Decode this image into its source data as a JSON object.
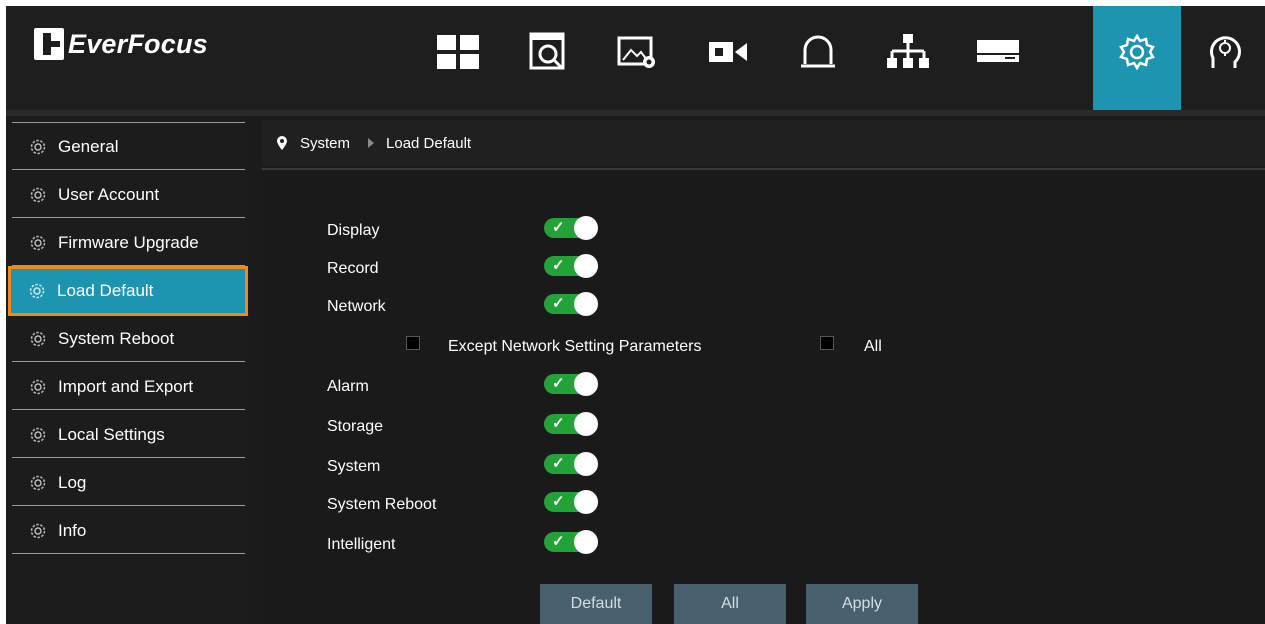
{
  "brand": {
    "name": "EverFocus"
  },
  "topnav": {
    "icons": [
      {
        "name": "live-view-grid"
      },
      {
        "name": "playback-search"
      },
      {
        "name": "image-settings"
      },
      {
        "name": "camera"
      },
      {
        "name": "alarm-bell"
      },
      {
        "name": "network"
      },
      {
        "name": "storage-hdd"
      },
      {
        "name": "system-settings",
        "active": true
      },
      {
        "name": "intelligent-analytics"
      }
    ],
    "active_color": "#1e95b0"
  },
  "sidebar": {
    "items": [
      {
        "label": "General"
      },
      {
        "label": "User Account"
      },
      {
        "label": "Firmware Upgrade"
      },
      {
        "label": "Load Default",
        "active": true
      },
      {
        "label": "System Reboot"
      },
      {
        "label": "Import and Export"
      },
      {
        "label": "Local Settings"
      },
      {
        "label": "Log"
      },
      {
        "label": "Info"
      }
    ],
    "highlight_color": "#f08a1c"
  },
  "breadcrumb": {
    "root": "System",
    "current": "Load Default"
  },
  "options": [
    {
      "label": "Display",
      "enabled": true
    },
    {
      "label": "Record",
      "enabled": true
    },
    {
      "label": "Network",
      "enabled": true
    },
    {
      "label": "Alarm",
      "enabled": true
    },
    {
      "label": "Storage",
      "enabled": true
    },
    {
      "label": "System",
      "enabled": true
    },
    {
      "label": "System Reboot",
      "enabled": true
    },
    {
      "label": "Intelligent",
      "enabled": true
    }
  ],
  "network_sub": {
    "except_label": "Except Network Setting Parameters",
    "except_checked": false,
    "all_label": "All",
    "all_checked": false
  },
  "toggle_on_color": "#23a238",
  "buttons": {
    "default": "Default",
    "all": "All",
    "apply": "Apply"
  }
}
